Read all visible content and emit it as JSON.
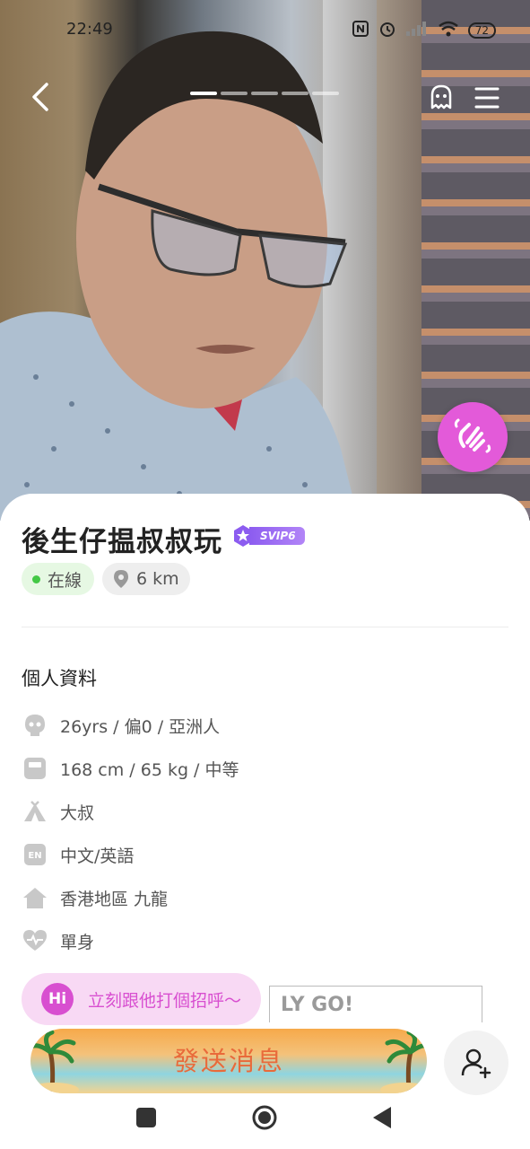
{
  "status_bar": {
    "time": "22:49",
    "battery": "72"
  },
  "photo": {
    "page_count": 5,
    "active_index": 0
  },
  "profile": {
    "name": "後生仔揾叔叔玩",
    "vip_badge": "SVIP6",
    "online_label": "在線",
    "distance": "6 km"
  },
  "info": {
    "section_title": "個人資料",
    "rows": [
      {
        "icon": "face-icon",
        "text": "26yrs / 偏0 / 亞洲人"
      },
      {
        "icon": "scale-icon",
        "text": "168 cm / 65 kg / 中等"
      },
      {
        "icon": "camp-icon",
        "text": "大叔"
      },
      {
        "icon": "language-icon",
        "text": "中文/英語"
      },
      {
        "icon": "home-icon",
        "text": "香港地區 九龍"
      },
      {
        "icon": "heart-icon",
        "text": "單身"
      }
    ]
  },
  "partial_card_text": "LY GO!",
  "greeting": {
    "icon_text": "Hi",
    "text": "立刻跟他打個招呼～"
  },
  "actions": {
    "send_message": "發送消息"
  },
  "colors": {
    "accent": "#d84fd0",
    "wave_button": "#e35ad9",
    "online_dot": "#43c845",
    "send_text": "#e96a3a"
  }
}
